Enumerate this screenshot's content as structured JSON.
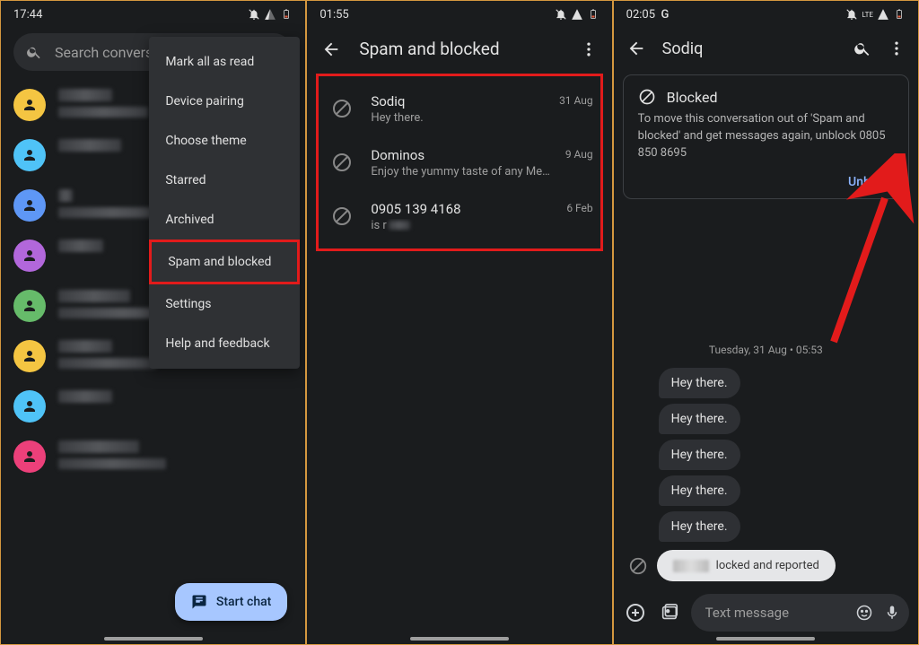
{
  "phone1": {
    "time": "17:44",
    "search_placeholder": "Search conversat",
    "menu": {
      "mark_all": "Mark all as read",
      "device_pairing": "Device pairing",
      "choose_theme": "Choose theme",
      "starred": "Starred",
      "archived": "Archived",
      "spam_blocked": "Spam and blocked",
      "settings": "Settings",
      "help": "Help and feedback"
    },
    "fab_label": "Start chat",
    "avatar_colors": [
      "#f4c542",
      "#4fc3f7",
      "#5e97f6",
      "#b267db",
      "#66bb6a",
      "#f4c542",
      "#4fc3f7",
      "#ec407a"
    ]
  },
  "phone2": {
    "time": "01:55",
    "title": "Spam and blocked",
    "items": [
      {
        "name": "Sodiq",
        "preview": "Hey there.",
        "date": "31 Aug"
      },
      {
        "name": "Dominos",
        "preview": "Enjoy the yummy taste of any Medium …",
        "date": "9 Aug"
      },
      {
        "name": "0905 139 4168",
        "preview": "is r",
        "date": "6 Feb"
      }
    ]
  },
  "phone3": {
    "time": "02:05",
    "status_extra": "G",
    "net_label": "LTE",
    "title": "Sodiq",
    "banner": {
      "heading": "Blocked",
      "body": "To move this conversation out of 'Spam and blocked' and get messages again, unblock 0805 850 8695",
      "action": "Unblock"
    },
    "date_label": "Tuesday, 31 Aug • 05:53",
    "messages": [
      "Hey there.",
      "Hey there.",
      "Hey there.",
      "Hey there.",
      "Hey there."
    ],
    "snackbar_tail": "locked and reported",
    "composer_placeholder": "Text message"
  }
}
